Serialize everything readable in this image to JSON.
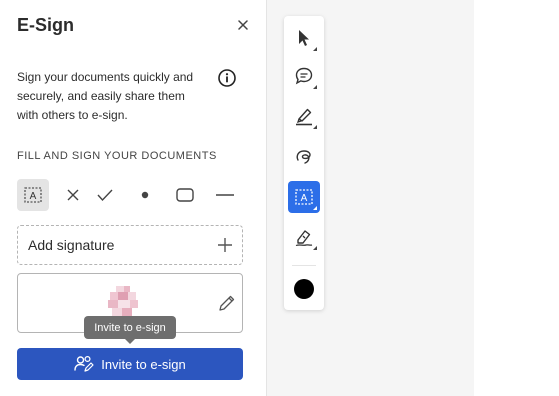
{
  "panel": {
    "title": "E-Sign",
    "close_icon": "close-icon",
    "description": "Sign your documents quickly and securely, and easily share them with others to e-sign.",
    "info_icon": "info-icon",
    "section_label": "FILL AND SIGN YOUR DOCUMENTS",
    "tools": [
      {
        "name": "text-field-icon",
        "active": true
      },
      {
        "name": "cross-mark-icon",
        "active": false
      },
      {
        "name": "check-mark-icon",
        "active": false
      },
      {
        "name": "dot-icon",
        "active": false
      },
      {
        "name": "rounded-rectangle-icon",
        "active": false
      },
      {
        "name": "line-icon",
        "active": false
      }
    ],
    "add_signature": "Add signature",
    "tooltip": "Invite to e-sign",
    "invite_button": "Invite to e-sign"
  },
  "vertical_toolbar": {
    "tools": [
      {
        "name": "select-arrow-icon",
        "active": false
      },
      {
        "name": "comment-icon",
        "active": false
      },
      {
        "name": "highlighter-icon",
        "active": false
      },
      {
        "name": "draw-freehand-icon",
        "active": false
      },
      {
        "name": "text-field-icon",
        "active": true
      },
      {
        "name": "sign-pen-icon",
        "active": false
      }
    ],
    "current_color": "#000000"
  },
  "colors": {
    "accent": "#2c56bf",
    "active_tool": "#2c6ee8"
  }
}
